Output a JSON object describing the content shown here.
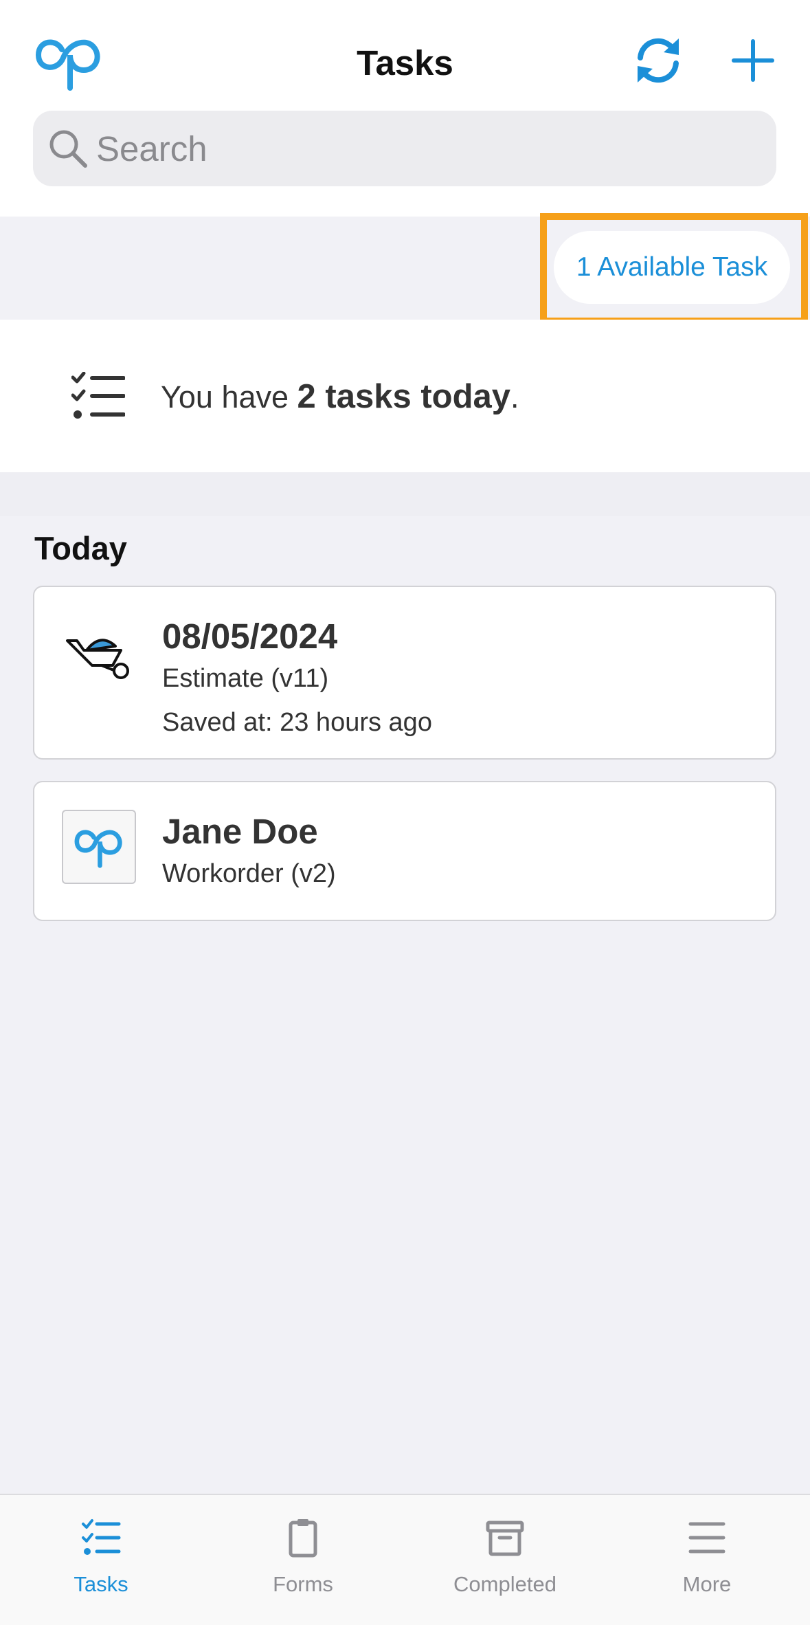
{
  "header": {
    "title": "Tasks",
    "search_placeholder": "Search"
  },
  "available": {
    "label": "1 Available Task"
  },
  "summary": {
    "prefix": "You have ",
    "highlight": "2 tasks today",
    "suffix": "."
  },
  "section": {
    "title": "Today"
  },
  "tasks": [
    {
      "title": "08/05/2024",
      "form": "Estimate (v11)",
      "saved": "Saved at: 23 hours ago"
    },
    {
      "title": "Jane Doe",
      "form": "Workorder (v2)"
    }
  ],
  "tabs": [
    {
      "label": "Tasks",
      "icon": "tasks-icon",
      "active": true
    },
    {
      "label": "Forms",
      "icon": "clipboard-icon",
      "active": false
    },
    {
      "label": "Completed",
      "icon": "archive-icon",
      "active": false
    },
    {
      "label": "More",
      "icon": "menu-icon",
      "active": false
    }
  ],
  "colors": {
    "accent": "#1b8fd8",
    "highlight": "#f6a019",
    "background": "#f1f1f6"
  }
}
